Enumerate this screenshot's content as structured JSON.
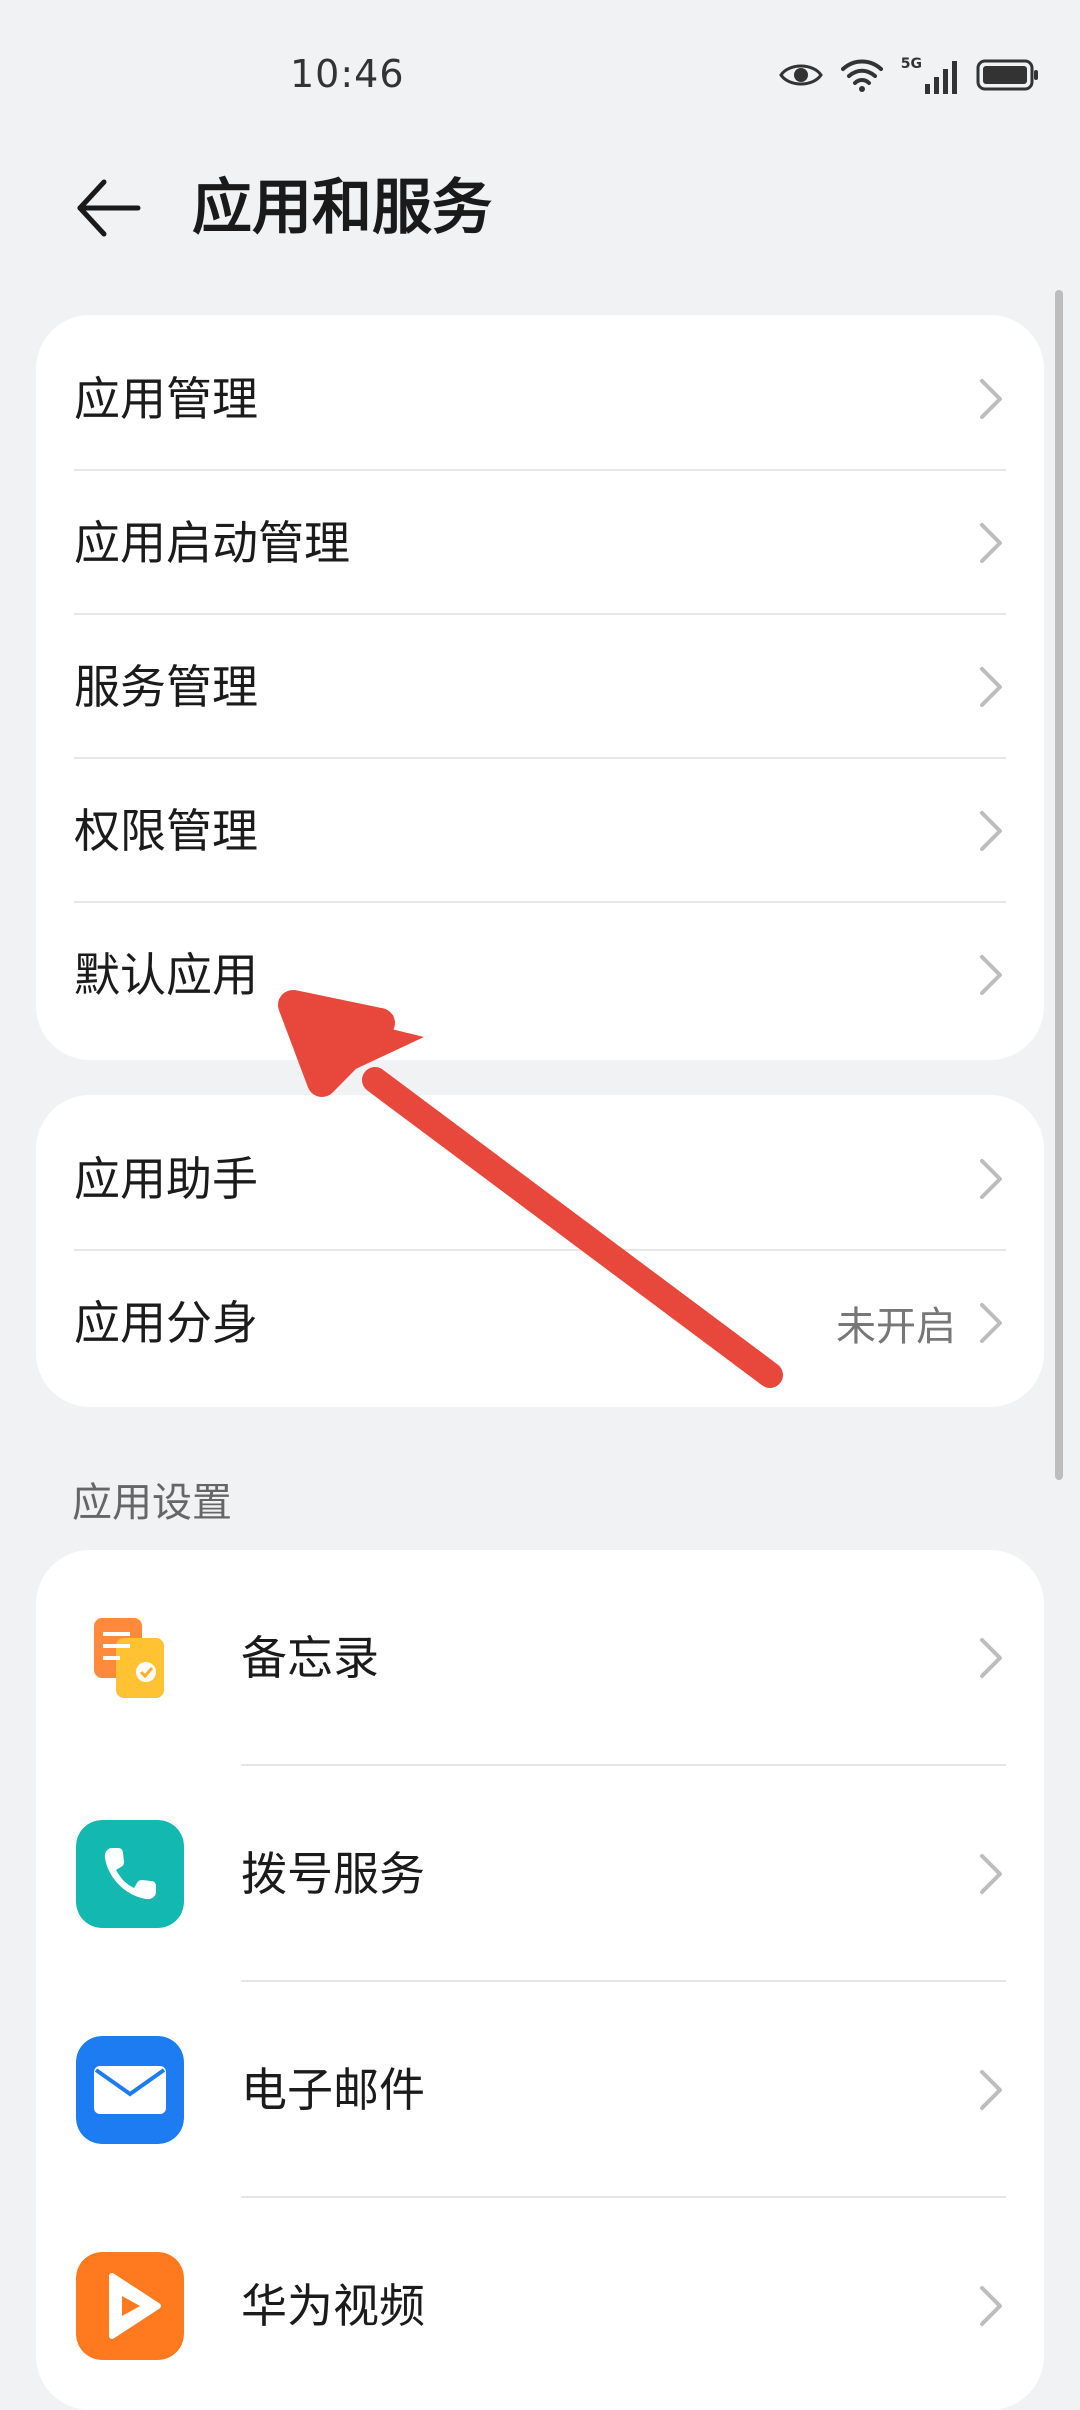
{
  "status_bar": {
    "time": "10:46",
    "network": "5G",
    "icons": [
      "eye-icon",
      "wifi-icon",
      "signal-icon",
      "battery-icon"
    ]
  },
  "header": {
    "title": "应用和服务",
    "back_icon": "arrow-left-icon"
  },
  "group1": {
    "items": [
      {
        "label": "应用管理"
      },
      {
        "label": "应用启动管理"
      },
      {
        "label": "服务管理"
      },
      {
        "label": "权限管理"
      },
      {
        "label": "默认应用"
      }
    ]
  },
  "group2": {
    "items": [
      {
        "label": "应用助手",
        "value": ""
      },
      {
        "label": "应用分身",
        "value": "未开启"
      }
    ]
  },
  "app_settings": {
    "section_title": "应用设置",
    "items": [
      {
        "label": "备忘录",
        "icon": "memo-icon"
      },
      {
        "label": "拨号服务",
        "icon": "phone-icon"
      },
      {
        "label": "电子邮件",
        "icon": "mail-icon"
      },
      {
        "label": "华为视频",
        "icon": "video-play-icon"
      }
    ]
  },
  "colors": {
    "background": "#f1f2f4",
    "card": "#ffffff",
    "annotation_arrow": "#e8473b",
    "phone_icon": "#13b8b0",
    "mail_icon": "#1e7cf2",
    "video_icon": "#ff7a1f",
    "memo_icon": "#ff8a3d"
  }
}
